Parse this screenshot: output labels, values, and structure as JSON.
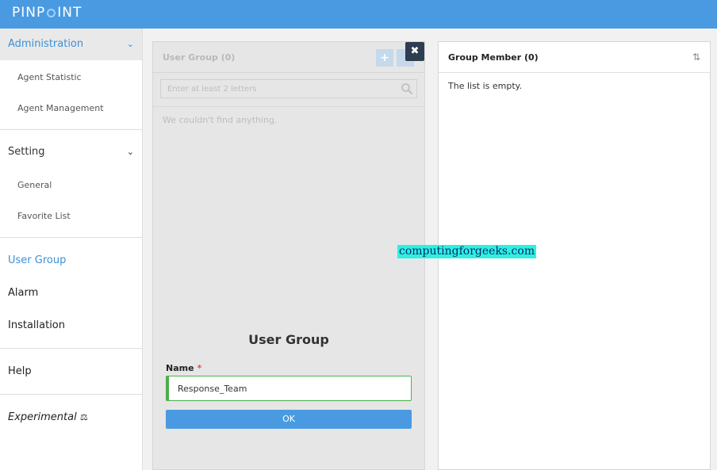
{
  "app": {
    "logo_text": "PINPOINT"
  },
  "sidebar": {
    "administration": {
      "label": "Administration",
      "items": [
        "Agent Statistic",
        "Agent Management"
      ]
    },
    "setting": {
      "label": "Setting",
      "items": [
        "General",
        "Favorite List"
      ]
    },
    "links": [
      "User Group",
      "Alarm",
      "Installation"
    ],
    "help": "Help",
    "experimental": "Experimental"
  },
  "user_group_panel": {
    "title": "User Group (0)",
    "search_placeholder": "Enter at least 2 letters",
    "empty_message": "We couldn't find anything."
  },
  "create_form": {
    "title": "User Group",
    "name_label": "Name",
    "required_mark": "*",
    "name_value": "Response_Team",
    "ok_label": "OK"
  },
  "group_member_panel": {
    "title": "Group Member (0)",
    "empty_message": "The list is empty."
  },
  "watermark": "computingforgeeks.com",
  "colors": {
    "brand": "#4a9ae1",
    "active_link": "#3d8fd8",
    "success_border": "#4cae4c"
  }
}
